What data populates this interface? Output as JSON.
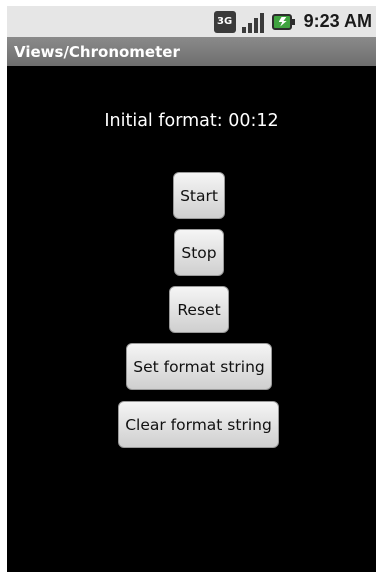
{
  "status_bar": {
    "network_label": "3G",
    "time": "9:23 AM"
  },
  "app_bar": {
    "title": "Views/Chronometer"
  },
  "chronometer": {
    "text": "Initial format: 00:12"
  },
  "buttons": {
    "start": "Start",
    "stop": "Stop",
    "reset": "Reset",
    "set_format": "Set format string",
    "clear_format": "Clear format string"
  }
}
